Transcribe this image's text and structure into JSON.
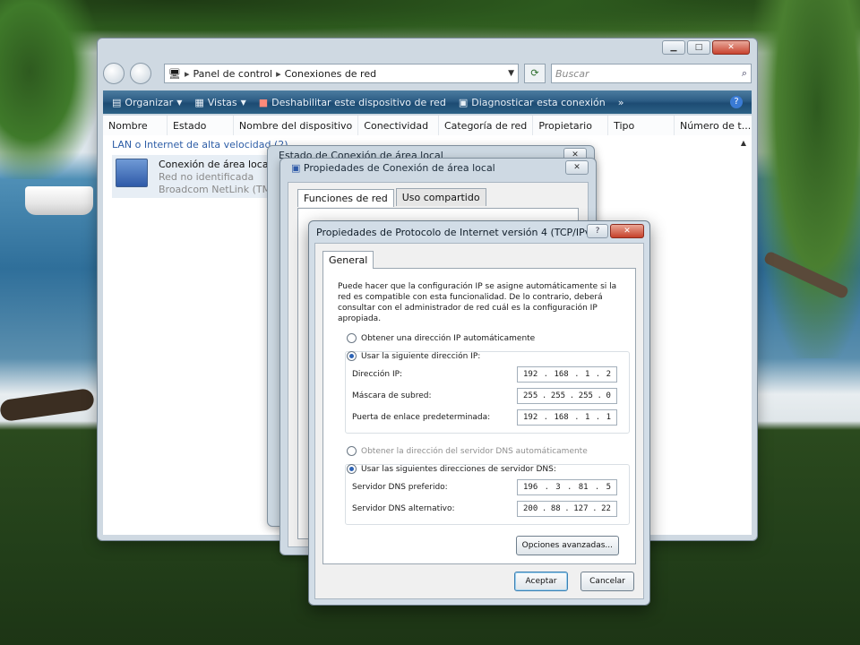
{
  "explorer": {
    "breadcrumb": [
      "Panel de control",
      "Conexiones de red"
    ],
    "search_placeholder": "Buscar",
    "toolbar": {
      "organize": "Organizar",
      "views": "Vistas",
      "disable": "Deshabilitar este dispositivo de red",
      "diagnose": "Diagnosticar esta conexión"
    },
    "columns": [
      "Nombre",
      "Estado",
      "Nombre del dispositivo",
      "Conectividad",
      "Categoría de red",
      "Propietario",
      "Tipo",
      "Número de t..."
    ],
    "group": "LAN o Internet de alta velocidad (2)",
    "item": {
      "name": "Conexión de área local",
      "status": "Red no identificada",
      "device": "Broadcom NetLink (TM) F"
    }
  },
  "status_dialog": {
    "title": "Estado de Conexión de área local"
  },
  "props_dialog": {
    "title": "Propiedades de Conexión de área local",
    "tabs": [
      "Funciones de red",
      "Uso compartido"
    ]
  },
  "ipv4_dialog": {
    "title": "Propiedades de Protocolo de Internet versión 4 (TCP/IPv4)",
    "tab": "General",
    "description": "Puede hacer que la configuración IP se asigne automáticamente si la red es compatible con esta funcionalidad. De lo contrario, deberá consultar con el administrador de red cuál es la configuración IP apropiada.",
    "auto_ip": "Obtener una dirección IP automáticamente",
    "manual_ip": "Usar la siguiente dirección IP:",
    "ip_label": "Dirección IP:",
    "ip_value": [
      "192",
      "168",
      "1",
      "2"
    ],
    "mask_label": "Máscara de subred:",
    "mask_value": [
      "255",
      "255",
      "255",
      "0"
    ],
    "gateway_label": "Puerta de enlace predeterminada:",
    "gateway_value": [
      "192",
      "168",
      "1",
      "1"
    ],
    "auto_dns": "Obtener la dirección del servidor DNS automáticamente",
    "manual_dns": "Usar las siguientes direcciones de servidor DNS:",
    "dns1_label": "Servidor DNS preferido:",
    "dns1_value": [
      "196",
      "3",
      "81",
      "5"
    ],
    "dns2_label": "Servidor DNS alternativo:",
    "dns2_value": [
      "200",
      "88",
      "127",
      "22"
    ],
    "advanced": "Opciones avanzadas...",
    "ok": "Aceptar",
    "cancel": "Cancelar"
  }
}
